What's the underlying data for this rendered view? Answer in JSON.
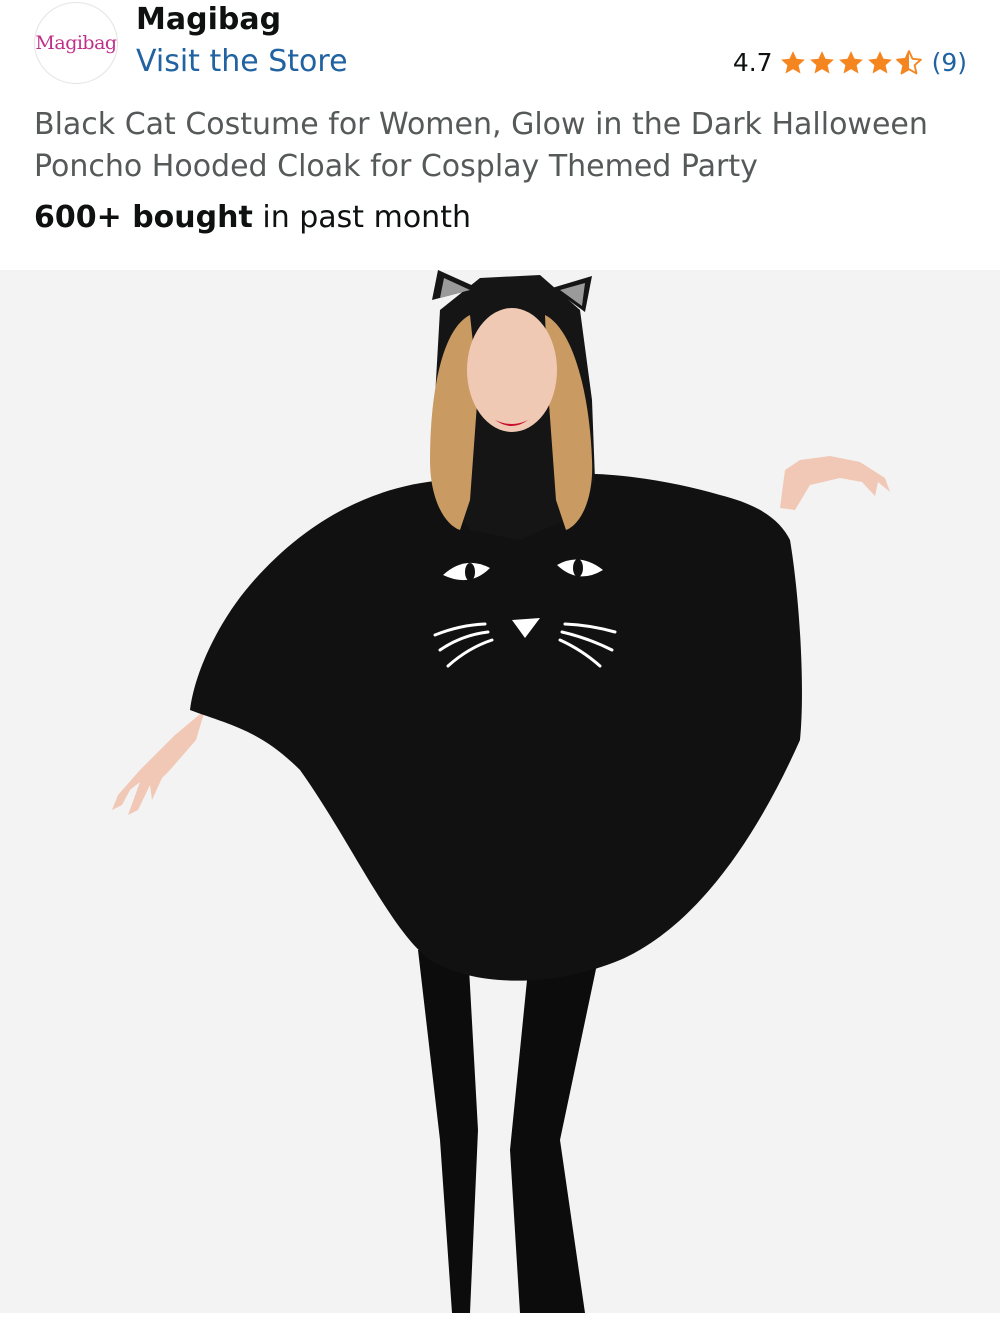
{
  "store": {
    "logo_text": "Magibag",
    "name": "Magibag",
    "link_label": "Visit the Store"
  },
  "rating": {
    "value": "4.7",
    "stars": 4.5,
    "count_label": "(9)",
    "star_color": "#f5851f"
  },
  "product": {
    "title": "Black Cat Costume for Women, Glow in the Dark Halloween Poncho Hooded Cloak for Cosplay Themed Party",
    "bought_bold": "600+ bought",
    "bought_rest": " in past month",
    "image_subject": "woman wearing black hooded cat poncho with cat ears and white cat face print"
  },
  "colors": {
    "link": "#2162a1",
    "text": "#0f1111",
    "secondary_text": "#565959",
    "image_bg": "#f3f3f3"
  }
}
